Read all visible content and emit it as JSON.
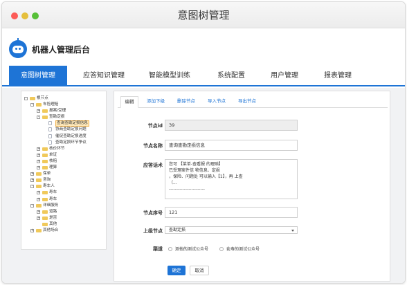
{
  "window": {
    "title": "意图树管理"
  },
  "brand": {
    "name": "机器人管理后台"
  },
  "nav": [
    {
      "label": "意图树管理",
      "active": true
    },
    {
      "label": "应答知识管理",
      "active": false
    },
    {
      "label": "智能模型训练",
      "active": false
    },
    {
      "label": "系统配置",
      "active": false
    },
    {
      "label": "用户管理",
      "active": false
    },
    {
      "label": "报表管理",
      "active": false
    }
  ],
  "tree": [
    {
      "level": 0,
      "toggle": "-",
      "label": "根节点"
    },
    {
      "level": 1,
      "toggle": "-",
      "label": "车险理赔"
    },
    {
      "level": 2,
      "toggle": "+",
      "label": "报案/受理"
    },
    {
      "level": 2,
      "toggle": "-",
      "label": "查勘定损"
    },
    {
      "level": 3,
      "toggle": "",
      "label": "查询查勘定损信息",
      "selected": true
    },
    {
      "level": 3,
      "toggle": "",
      "label": "协商查勘定损问题"
    },
    {
      "level": 3,
      "toggle": "",
      "label": "催促查勘定损进度"
    },
    {
      "level": 3,
      "toggle": "",
      "label": "查勘定损环节争议"
    },
    {
      "level": 2,
      "toggle": "+",
      "label": "核价环节"
    },
    {
      "level": 2,
      "toggle": "+",
      "label": "单证"
    },
    {
      "level": 2,
      "toggle": "+",
      "label": "核赔"
    },
    {
      "level": 2,
      "toggle": "+",
      "label": "理算"
    },
    {
      "level": 1,
      "toggle": "+",
      "label": "保单"
    },
    {
      "level": 1,
      "toggle": "+",
      "label": "咨询"
    },
    {
      "level": 1,
      "toggle": "-",
      "label": "寿车人"
    },
    {
      "level": 2,
      "toggle": "+",
      "label": "寿车"
    },
    {
      "level": 2,
      "toggle": "+",
      "label": "寿车"
    },
    {
      "level": 1,
      "toggle": "-",
      "label": "详细服务"
    },
    {
      "level": 2,
      "toggle": "+",
      "label": "道路"
    },
    {
      "level": 2,
      "toggle": "+",
      "label": "是否"
    },
    {
      "level": 2,
      "toggle": "",
      "label": "其他"
    },
    {
      "level": 1,
      "toggle": "+",
      "label": "其他场合"
    }
  ],
  "tabs": [
    {
      "label": "编辑",
      "active": true
    },
    {
      "label": "添加下级",
      "active": false
    },
    {
      "label": "删除节点",
      "active": false
    },
    {
      "label": "导入节点",
      "active": false
    },
    {
      "label": "导出节点",
      "active": false
    }
  ],
  "form": {
    "node_id": {
      "label": "节点id",
      "value": "39"
    },
    "node_name": {
      "label": "节点名称",
      "value": "查询查勘定损信息"
    },
    "answer": {
      "label": "应答话术",
      "lines": [
        "您可 【菜单-查看报 的理赔】",
        "已受理案件信 物信息、定损",
        "，保险、问题处 可以输入【1】，再 上查",
        "（...",
        "------------------------"
      ]
    },
    "order": {
      "label": "节点序号",
      "value": "121"
    },
    "parent": {
      "label": "上级节点",
      "value": "查勘定损"
    },
    "channel": {
      "label": "渠道",
      "options": [
        "测他的测试公众号",
        "俞寿的测试公众号"
      ]
    }
  },
  "buttons": {
    "confirm": "确定",
    "cancel": "取消"
  },
  "colors": {
    "accent": "#1e74d6",
    "folder": "#f0c95b",
    "selected": "#ffe8b8"
  }
}
